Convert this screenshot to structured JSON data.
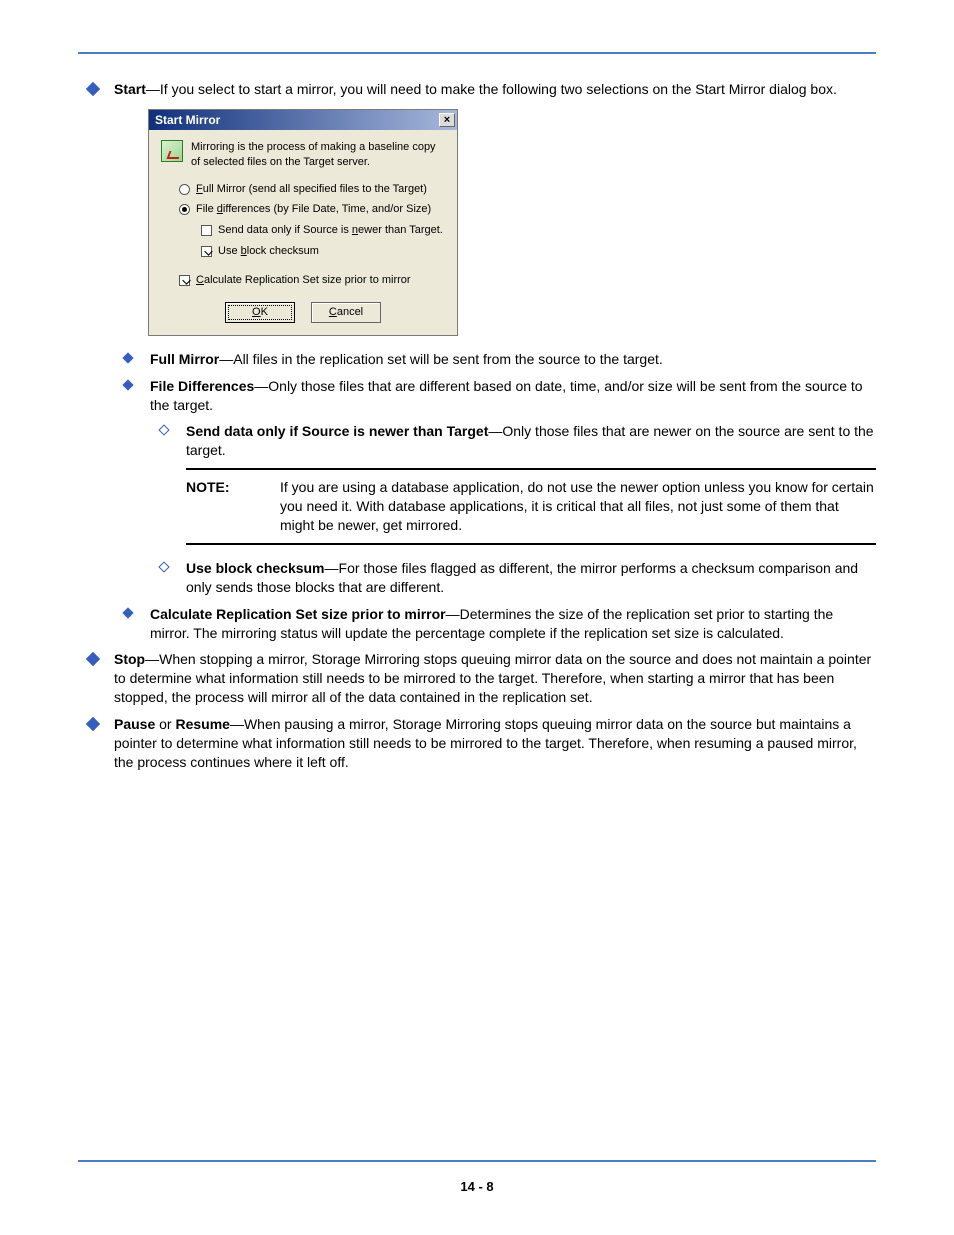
{
  "page_number": "14 - 8",
  "top": {
    "start_bold": "Start",
    "start_rest": "—If you select to start a mirror, you will need to make the following two selections on the Start Mirror dialog box."
  },
  "dialog": {
    "title": "Start Mirror",
    "close": "×",
    "intro": "Mirroring is the process of making a baseline copy of selected files on the Target server.",
    "radio_full_pre": "F",
    "radio_full_rest": "ull Mirror (send all specified files to the Target)",
    "radio_diff_pre": "File ",
    "radio_diff_mid": "d",
    "radio_diff_rest": "ifferences (by File Date, Time, and/or Size)",
    "chk_newer_pre": "Send data only if Source is ",
    "chk_newer_mid": "n",
    "chk_newer_rest": "ewer than Target.",
    "chk_blk_pre": "Use ",
    "chk_blk_mid": "b",
    "chk_blk_rest": "lock checksum",
    "chk_calc_pre": "C",
    "chk_calc_rest": "alculate Replication Set size prior to mirror",
    "ok_pre": "O",
    "ok_rest": "K",
    "cancel_pre": "C",
    "cancel_rest": "ancel"
  },
  "bullets": {
    "full_b": "Full Mirror",
    "full_r": "—All files in the replication set will be sent from the source to the target.",
    "diff_b": "File Differences",
    "diff_r": "—Only those files that are different based on date, time, and/or size will be sent from the source to the target.",
    "send_b": "Send data only if Source is newer than Target",
    "send_r": "—Only those files that are newer on the source  are sent to the target.",
    "blk_b": "Use block checksum",
    "blk_r": "—For those files flagged as different, the mirror performs a checksum comparison and only sends those blocks that are different.",
    "calc_b": "Calculate Replication Set size prior to mirror",
    "calc_r": "—Determines the size of the replication set prior to starting the mirror. The mirroring status will update the percentage complete if the replication set size is calculated.",
    "stop_b": "Stop",
    "stop_r": "—When stopping a mirror, Storage Mirroring stops queuing mirror data on the source and does not maintain a pointer to determine what information still needs to be mirrored to the target.  Therefore, when starting a mirror that has been stopped, the process will mirror all of the data contained in the replication set.",
    "pause_b1": "Pause",
    "pause_mid": " or ",
    "pause_b2": "Resume",
    "pause_r": "—When pausing a mirror, Storage Mirroring stops queuing mirror data on the source but maintains a pointer to determine what information still needs to be mirrored to the target.  Therefore, when resuming a paused mirror, the process continues where it left off."
  },
  "note": {
    "label": "NOTE:",
    "text": "If you are using a database application, do not use the newer option unless you know for certain you need it. With database applications, it is critical that all files, not just some of them that might be newer, get mirrored."
  }
}
